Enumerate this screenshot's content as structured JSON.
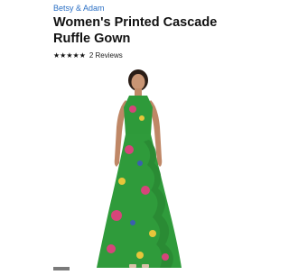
{
  "product": {
    "brand": "Betsy & Adam",
    "title": "Women's Printed Cascade Ruffle Gown",
    "rating": 5,
    "reviews_label": "2 Reviews"
  },
  "icons": {
    "star": "star-icon"
  },
  "colors": {
    "brand_link": "#2a6fc4",
    "dress_green": "#2e9a3a",
    "floral_pink": "#d6457a",
    "floral_yellow": "#e8c53a",
    "floral_blue": "#3a5fb0"
  }
}
